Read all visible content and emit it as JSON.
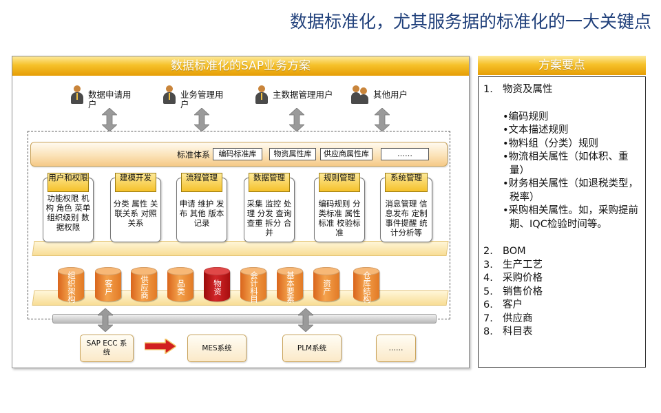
{
  "slide_title": "数据标准化，尤其服务据的标准化的一大关键点",
  "left_panel": {
    "title": "数据标准化的SAP业务方案",
    "users": [
      {
        "label": "数据申请用户",
        "icon": "person-icon"
      },
      {
        "label": "业务管理用户",
        "icon": "person-icon"
      },
      {
        "label": "主数据管理用户",
        "icon": "person-icon"
      },
      {
        "label": "其他用户",
        "icon": "group-icon"
      }
    ],
    "standards": {
      "label": "标准体系",
      "tags": [
        "编码标准库",
        "物资属性库",
        "供应商属性库",
        "……"
      ]
    },
    "modules": [
      {
        "title": "用户和权限",
        "body": "功能权限 机构 角色 菜单 组织级别 数据权限"
      },
      {
        "title": "建模开发",
        "body": "分类 属性 关联关系 对照关系"
      },
      {
        "title": "流程管理",
        "body": "申请 维护 发布 其他 版本记录"
      },
      {
        "title": "数据管理",
        "body": "采集 监控 处理 分发 查询 查重 拆分 合并"
      },
      {
        "title": "规则管理",
        "body": "编码规则 分类标准 属性标准 校验标准"
      },
      {
        "title": "系统管理",
        "body": "消息管理 信息发布 定制事件提醒 统计分析等"
      }
    ],
    "data_stores": [
      {
        "label": "组织架构",
        "highlight": false
      },
      {
        "label": "客户",
        "highlight": false
      },
      {
        "label": "供应商",
        "highlight": false
      },
      {
        "label": "品类",
        "highlight": false
      },
      {
        "label": "物资",
        "highlight": true
      },
      {
        "label": "会计科目",
        "highlight": false
      },
      {
        "label": "基本要素",
        "highlight": false
      },
      {
        "label": "资产",
        "highlight": false
      },
      {
        "label": "仓库结构",
        "highlight": false
      }
    ],
    "systems": [
      "SAP ECC 系统",
      "MES系统",
      "PLM系统",
      "……"
    ],
    "colors": {
      "bar": "#f6c12a",
      "cylinder": "#ef8a33",
      "highlight": "#c21a1a",
      "arrow": "#d11f1f"
    }
  },
  "right_panel": {
    "title": "方案要点",
    "items": [
      {
        "num": "1.",
        "text": "物资及属性"
      },
      {
        "num": "2.",
        "text": "BOM"
      },
      {
        "num": "3.",
        "text": "生产工艺"
      },
      {
        "num": "4.",
        "text": "采购价格"
      },
      {
        "num": "5.",
        "text": "销售价格"
      },
      {
        "num": "6.",
        "text": "客户"
      },
      {
        "num": "7.",
        "text": "供应商"
      },
      {
        "num": "8.",
        "text": "科目表"
      }
    ],
    "sub_bullets": [
      "•编码规则",
      "•文本描述规则",
      "•物料组（分类）规则",
      "•物流相关属性（如体积、重量）",
      "•财务相关属性（如退税类型，税率）",
      "•采购相关属性。如，采购提前期、IQC检验时间等。"
    ]
  }
}
